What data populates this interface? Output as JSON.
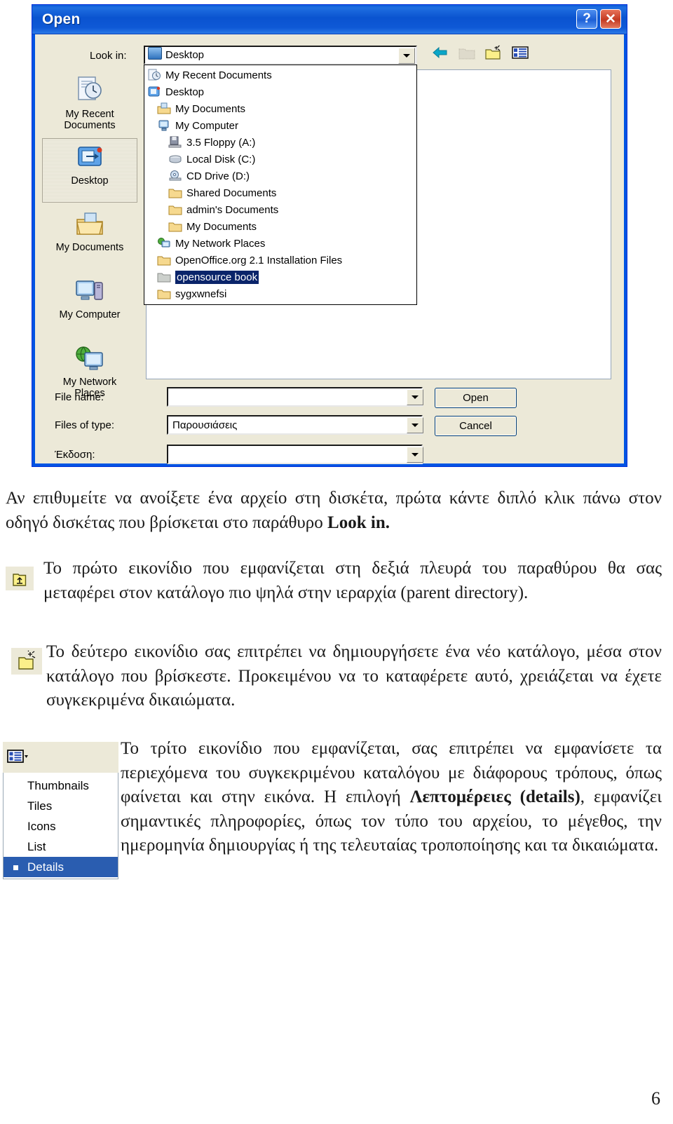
{
  "dialog": {
    "title": "Open",
    "title_buttons": [
      {
        "name": "help",
        "glyph": "?"
      },
      {
        "name": "close",
        "glyph": "✕"
      }
    ],
    "lookin": {
      "label": "Look in:",
      "value": "Desktop"
    },
    "toolbar": [
      {
        "name": "back-icon",
        "label": "Back"
      },
      {
        "name": "up-one-level-icon",
        "label": "Up One Level"
      },
      {
        "name": "create-new-folder-icon",
        "label": "Create New Folder"
      },
      {
        "name": "views-icon",
        "label": "Views"
      }
    ],
    "places": [
      {
        "label": "My Recent\nDocuments",
        "icon": "recent-documents-icon",
        "selected": false
      },
      {
        "label": "Desktop",
        "icon": "desktop-icon",
        "selected": true
      },
      {
        "label": "My Documents",
        "icon": "my-documents-icon",
        "selected": false
      },
      {
        "label": "My Computer",
        "icon": "my-computer-icon",
        "selected": false
      },
      {
        "label": "My Network\nPlaces",
        "icon": "my-network-places-icon",
        "selected": false
      }
    ],
    "dropdown_items": [
      {
        "label": "My Recent Documents",
        "icon": "recent-documents-icon",
        "indent": 0,
        "selected": false
      },
      {
        "label": "Desktop",
        "icon": "desktop-icon",
        "indent": 0,
        "selected": false
      },
      {
        "label": "My Documents",
        "icon": "my-documents-icon",
        "indent": 1,
        "selected": false
      },
      {
        "label": "My Computer",
        "icon": "my-computer-icon",
        "indent": 1,
        "selected": false
      },
      {
        "label": "3.5 Floppy (A:)",
        "icon": "floppy-drive-icon",
        "indent": 2,
        "selected": false
      },
      {
        "label": "Local Disk (C:)",
        "icon": "hard-disk-icon",
        "indent": 2,
        "selected": false
      },
      {
        "label": "CD Drive (D:)",
        "icon": "cd-drive-icon",
        "indent": 2,
        "selected": false
      },
      {
        "label": "Shared Documents",
        "icon": "folder-icon",
        "indent": 2,
        "selected": false
      },
      {
        "label": "admin's Documents",
        "icon": "folder-icon",
        "indent": 2,
        "selected": false
      },
      {
        "label": "My Documents",
        "icon": "folder-icon",
        "indent": 2,
        "selected": false
      },
      {
        "label": "My Network Places",
        "icon": "my-network-places-icon",
        "indent": 1,
        "selected": false
      },
      {
        "label": "OpenOffice.org 2.1 Installation Files",
        "icon": "folder-icon",
        "indent": 1,
        "selected": false
      },
      {
        "label": "opensource book",
        "icon": "folder-grey-icon",
        "indent": 1,
        "selected": true
      },
      {
        "label": "sygxwnefsi",
        "icon": "folder-icon",
        "indent": 1,
        "selected": false
      }
    ],
    "fields": [
      {
        "label": "File name:",
        "value": ""
      },
      {
        "label": "Files of type:",
        "value": "Παρουσιάσεις"
      },
      {
        "label": "Έκδοση:",
        "value": ""
      }
    ],
    "buttons": {
      "open": "Open",
      "cancel": "Cancel"
    }
  },
  "document": {
    "paragraph_1": "Αν επιθυμείτε να ανοίξετε ένα αρχείο στη δισκέτα, πρώτα κάντε διπλό κλικ πάνω στον οδηγό δισκέτας που βρίσκεται στο παράθυρο ",
    "paragraph_1_bold": "Look in.",
    "paragraph_2": "Το πρώτο εικονίδιο που εμφανίζεται στη δεξιά πλευρά του παραθύρου θα σας μεταφέρει στον κατάλογο πιο ψηλά στην ιεραρχία (parent directory).",
    "paragraph_3": "Το δεύτερο εικονίδιο σας επιτρέπει να δημιουργήσετε ένα νέο κατάλογο, μέσα στον κατάλογο που βρίσκεστε.  Προκειμένου να το καταφέρετε αυτό, χρειάζεται να έχετε συγκεκριμένα δικαιώματα.",
    "paragraph_4_a": "Το τρίτο εικονίδιο που εμφανίζεται, σας επιτρέπει να εμφανίσετε τα περιεχόμενα του συγκεκριμένου καταλόγου με διάφορους τρόπους, όπως φαίνεται και στην εικόνα.  Η επιλογή ",
    "paragraph_4_bold": "Λεπτομέρειες (details)",
    "paragraph_4_b": ", εμφανίζει σημαντικές πληροφορίες, όπως τον τύπο του αρχείου, το μέγεθος, την ημερομηνία δημιουργίας ή της τελευταίας τροποποίησης και τα δικαιώματα.",
    "page_number": "6"
  },
  "views_menu": {
    "items": [
      {
        "label": "Thumbnails",
        "active": false
      },
      {
        "label": "Tiles",
        "active": false
      },
      {
        "label": "Icons",
        "active": false
      },
      {
        "label": "List",
        "active": false
      },
      {
        "label": "Details",
        "active": true
      }
    ]
  },
  "colors": {
    "titlebar_blue": "#0a53d0",
    "dialog_face": "#ece9d8",
    "selection_blue": "#0a246a",
    "menu_highlight": "#2a5db0",
    "folder_yellow": "#f5d98b"
  }
}
